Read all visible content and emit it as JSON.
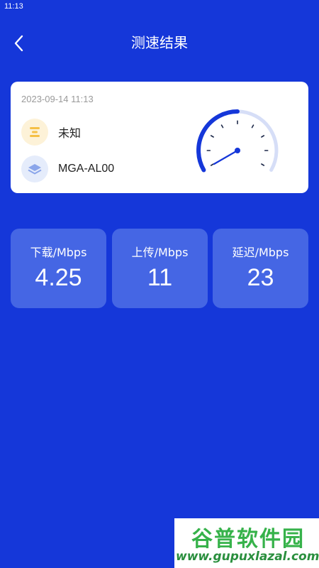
{
  "status_bar": {
    "time": "11:13"
  },
  "header": {
    "title": "测速结果",
    "back_icon": "chevron-left-icon"
  },
  "result_card": {
    "timestamp": "2023-09-14 11:13",
    "isp": {
      "icon": "isp-icon",
      "label": "未知"
    },
    "device": {
      "icon": "layers-icon",
      "label": "MGA-AL00"
    },
    "gauge": {
      "icon": "speedometer-icon",
      "accent": "#1537d9",
      "track": "#d6def7"
    }
  },
  "metrics": [
    {
      "label": "下载/Mbps",
      "value": "4.25"
    },
    {
      "label": "上传/Mbps",
      "value": "11"
    },
    {
      "label": "延迟/Mbps",
      "value": "23"
    }
  ],
  "watermark": {
    "title": "谷普软件园",
    "url": "www.gupuxlazal.com"
  },
  "colors": {
    "background": "#1537d9",
    "card": "#ffffff",
    "metric_card": "#4566e4",
    "isp_icon_bg": "#fdf2d8",
    "isp_icon_fg": "#f5c046",
    "device_icon_bg": "#e5ecfb",
    "device_icon_fg": "#8aa5ea"
  }
}
